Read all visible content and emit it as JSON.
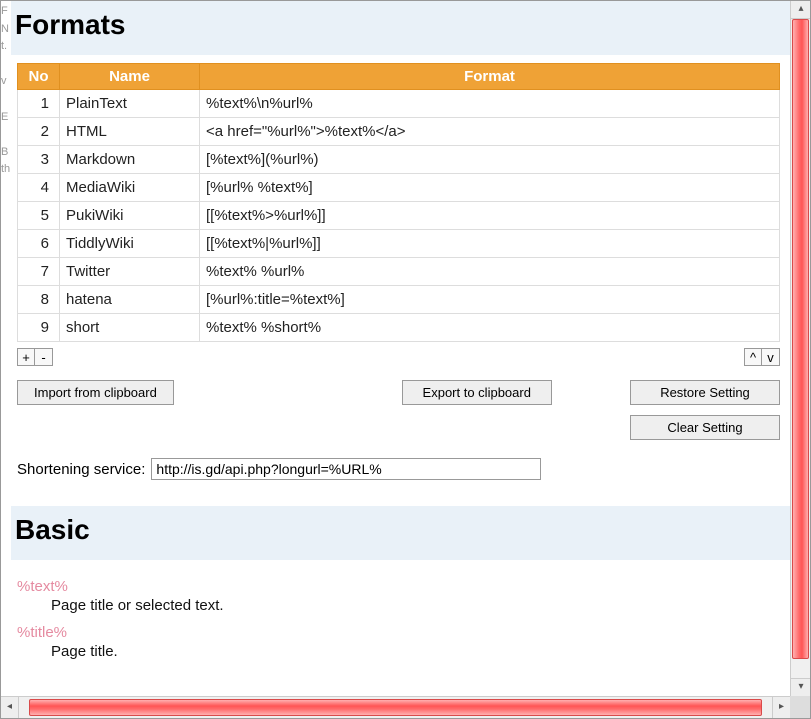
{
  "headings": {
    "formats": "Formats",
    "basic": "Basic"
  },
  "table": {
    "headers": {
      "no": "No",
      "name": "Name",
      "format": "Format"
    },
    "rows": [
      {
        "no": "1",
        "name": "PlainText",
        "format": "%text%\\n%url%"
      },
      {
        "no": "2",
        "name": "HTML",
        "format": "<a href=\"%url%\">%text%</a>"
      },
      {
        "no": "3",
        "name": "Markdown",
        "format": "[%text%](%url%)"
      },
      {
        "no": "4",
        "name": "MediaWiki",
        "format": "[%url% %text%]"
      },
      {
        "no": "5",
        "name": "PukiWiki",
        "format": "[[%text%>%url%]]"
      },
      {
        "no": "6",
        "name": "TiddlyWiki",
        "format": "[[%text%|%url%]]"
      },
      {
        "no": "7",
        "name": "Twitter",
        "format": "%text% %url%"
      },
      {
        "no": "8",
        "name": "hatena",
        "format": "[%url%:title=%text%]"
      },
      {
        "no": "9",
        "name": "short",
        "format": "%text% %short%"
      }
    ]
  },
  "buttons": {
    "add": "+",
    "remove": "-",
    "move_up": "^",
    "move_down": "v",
    "import": "Import from clipboard",
    "export": "Export to clipboard",
    "restore": "Restore Setting",
    "clear": "Clear Setting"
  },
  "shortening": {
    "label": "Shortening service:",
    "value": "http://is.gd/api.php?longurl=%URL%"
  },
  "variables": [
    {
      "token": "%text%",
      "desc": "Page title or selected text."
    },
    {
      "token": "%title%",
      "desc": "Page title."
    }
  ],
  "sliver_chars": [
    "F",
    "N",
    "t.",
    "",
    "v",
    "",
    "E",
    "",
    "B",
    "th"
  ]
}
